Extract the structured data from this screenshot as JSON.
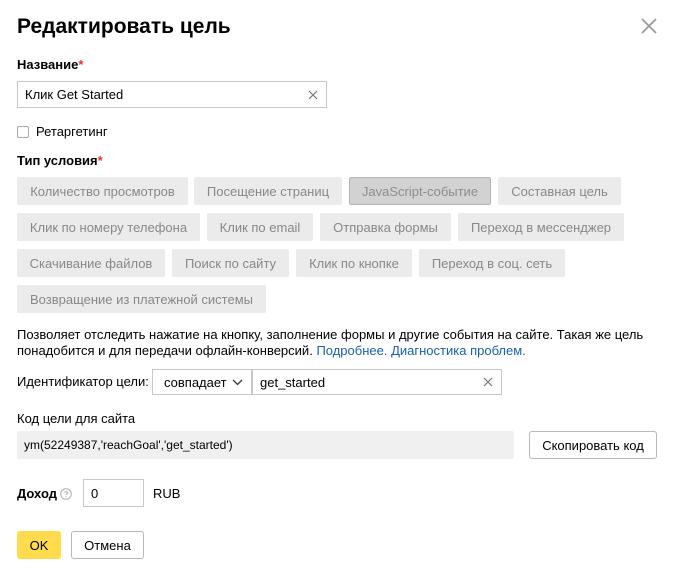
{
  "dialog": {
    "title": "Редактировать цель"
  },
  "name_field": {
    "label": "Название",
    "required_mark": "*",
    "value": "Клик Get Started"
  },
  "retargeting": {
    "label": "Ретаргетинг",
    "checked": false
  },
  "condition_type": {
    "label": "Тип условия",
    "required_mark": "*",
    "options": [
      "Количество просмотров",
      "Посещение страниц",
      "JavaScript-событие",
      "Составная цель",
      "Клик по номеру телефона",
      "Клик по email",
      "Отправка формы",
      "Переход в мессенджер",
      "Скачивание файлов",
      "Поиск по сайту",
      "Клик по кнопке",
      "Переход в соц. сеть",
      "Возвращение из платежной системы"
    ],
    "selected": "JavaScript-событие"
  },
  "description": {
    "text": "Позволяет отследить нажатие на кнопку, заполнение формы и другие события на сайте. Такая же цель понадобится и для передачи офлайн-конверсий.",
    "link_more": "Подробнее.",
    "link_diagnostics": "Диагностика проблем."
  },
  "identifier": {
    "label": "Идентификатор цели:",
    "match_value": "совпадает",
    "value": "get_started"
  },
  "code": {
    "label": "Код цели для сайта",
    "snippet": "ym(52249387,'reachGoal','get_started')",
    "copy_button": "Скопировать код"
  },
  "income": {
    "label": "Доход",
    "value": "0",
    "currency": "RUB"
  },
  "footer": {
    "ok": "OK",
    "cancel": "Отмена"
  }
}
